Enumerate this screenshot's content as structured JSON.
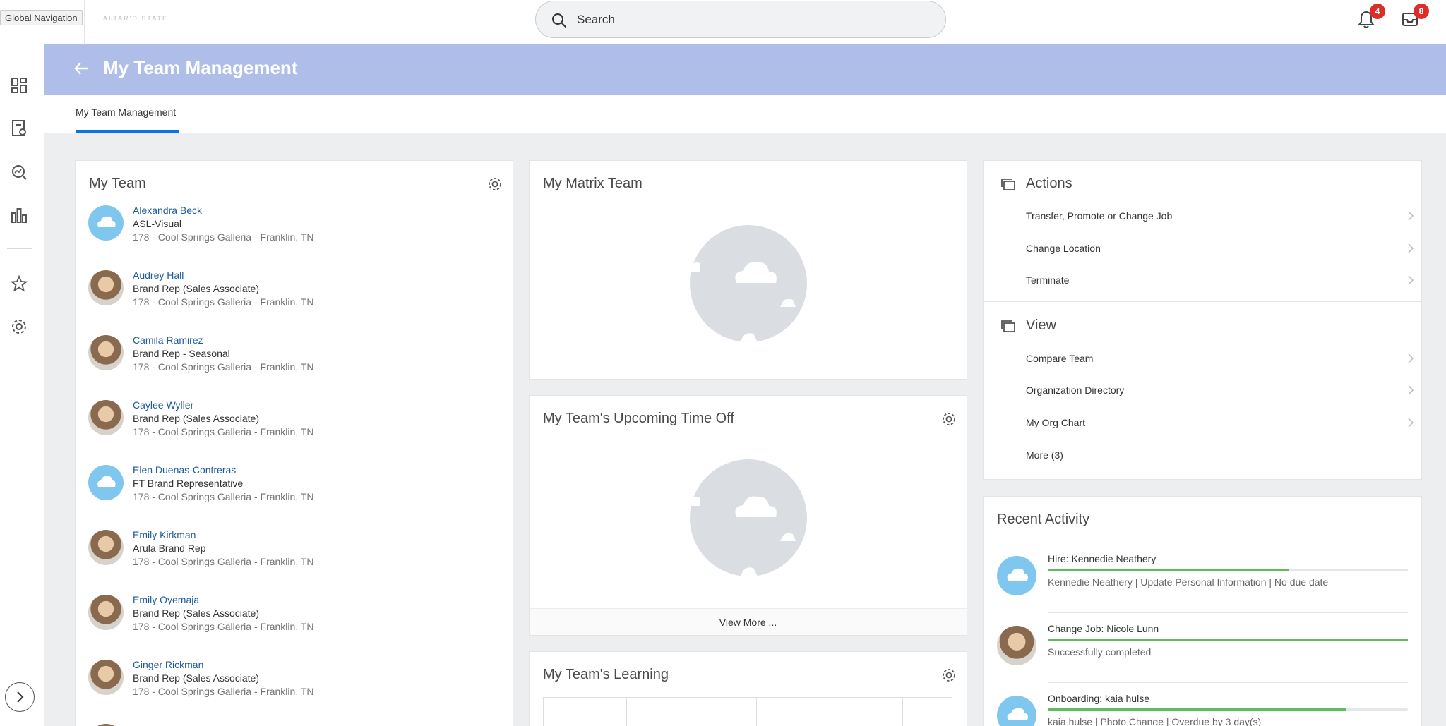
{
  "global_nav": {
    "label": "Global Navigation"
  },
  "brand": {
    "logo_text": "ALTAR'D STATE"
  },
  "search": {
    "placeholder": "Search"
  },
  "notifications": {
    "count": "4"
  },
  "inbox": {
    "count": "8"
  },
  "header": {
    "title": "My Team Management"
  },
  "tabs": [
    {
      "label": "My Team Management",
      "active": true
    }
  ],
  "my_team": {
    "title": "My Team",
    "members": [
      {
        "name": "Alexandra Beck",
        "role": "ASL-Visual",
        "location": "178 - Cool Springs Galleria - Franklin, TN",
        "avatar": "cloud"
      },
      {
        "name": "Audrey Hall",
        "role": "Brand Rep (Sales Associate)",
        "location": "178 - Cool Springs Galleria - Franklin, TN",
        "avatar": "photo"
      },
      {
        "name": "Camila Ramirez",
        "role": "Brand Rep - Seasonal",
        "location": "178 - Cool Springs Galleria - Franklin, TN",
        "avatar": "photo"
      },
      {
        "name": "Caylee Wyller",
        "role": "Brand Rep (Sales Associate)",
        "location": "178 - Cool Springs Galleria - Franklin, TN",
        "avatar": "photo"
      },
      {
        "name": "Elen Duenas-Contreras",
        "role": "FT Brand Representative",
        "location": "178 - Cool Springs Galleria - Franklin, TN",
        "avatar": "cloud"
      },
      {
        "name": "Emily Kirkman",
        "role": "Arula Brand Rep",
        "location": "178 - Cool Springs Galleria - Franklin, TN",
        "avatar": "photo"
      },
      {
        "name": "Emily Oyemaja",
        "role": "Brand Rep (Sales Associate)",
        "location": "178 - Cool Springs Galleria - Franklin, TN",
        "avatar": "photo"
      },
      {
        "name": "Ginger Rickman",
        "role": "Brand Rep (Sales Associate)",
        "location": "178 - Cool Springs Galleria - Franklin, TN",
        "avatar": "photo"
      }
    ]
  },
  "matrix_team": {
    "title": "My Matrix Team"
  },
  "time_off": {
    "title": "My Team's Upcoming Time Off",
    "view_more": "View More ..."
  },
  "learning": {
    "title": "My Team's Learning"
  },
  "actions": {
    "title": "Actions",
    "items": [
      {
        "label": "Transfer, Promote or Change Job"
      },
      {
        "label": "Change Location"
      },
      {
        "label": "Terminate"
      }
    ]
  },
  "view": {
    "title": "View",
    "items": [
      {
        "label": "Compare Team"
      },
      {
        "label": "Organization Directory"
      },
      {
        "label": "My Org Chart"
      }
    ],
    "more": "More (3)"
  },
  "recent_activity": {
    "title": "Recent Activity",
    "items": [
      {
        "title": "Hire: Kennedie Neathery",
        "subtitle": "Kennedie Neathery | Update Personal Information | No due date",
        "progress": 0.67,
        "avatar": "cloud"
      },
      {
        "title": "Change Job: Nicole Lunn",
        "subtitle": "Successfully completed",
        "progress": 1.0,
        "avatar": "photo"
      },
      {
        "title": "Onboarding: kaia hulse",
        "subtitle": "kaia hulse | Photo Change | Overdue by 3 day(s)",
        "progress": 0.83,
        "avatar": "cloud"
      }
    ]
  },
  "colors": {
    "header_band": "#aebee8",
    "link": "#1e5b9c",
    "badge": "#de2d26",
    "progress": "#5fbb5f",
    "tab_underline": "#0875e1"
  }
}
